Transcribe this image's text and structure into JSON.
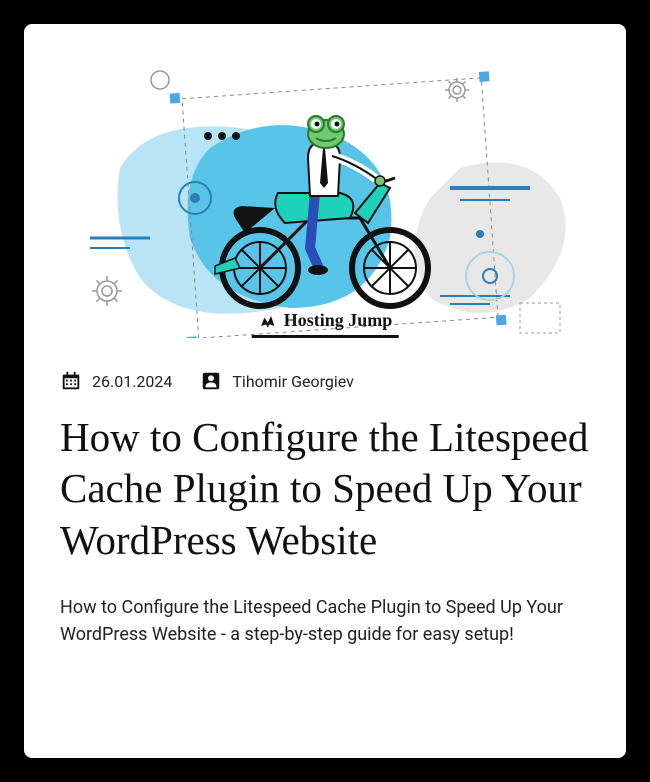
{
  "brand": {
    "name": "Hosting Jump"
  },
  "meta": {
    "date": "26.01.2024",
    "author": "Tihomir Georgiev"
  },
  "article": {
    "title": "How to Configure the Litespeed Cache Plugin to Speed Up Your WordPress Website",
    "excerpt": "How to Configure the Litespeed Cache Plugin to Speed Up Your WordPress Website - a step-by-step guide for easy setup!"
  }
}
